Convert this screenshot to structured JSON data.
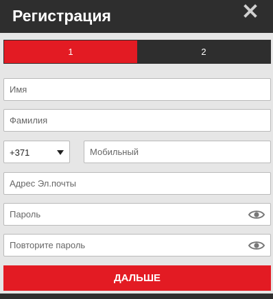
{
  "header": {
    "title": "Регистрация",
    "close_icon": "close-icon"
  },
  "steps": [
    {
      "label": "1",
      "active": true
    },
    {
      "label": "2",
      "active": false
    }
  ],
  "form": {
    "first_name": {
      "placeholder": "Имя",
      "value": ""
    },
    "last_name": {
      "placeholder": "Фамилия",
      "value": ""
    },
    "phone_code": {
      "selected": "+371"
    },
    "mobile": {
      "placeholder": "Мобильный",
      "value": ""
    },
    "email": {
      "placeholder": "Адрес Эл.почты",
      "value": ""
    },
    "password": {
      "placeholder": "Пароль",
      "value": "",
      "icon": "eye-icon"
    },
    "password_repeat": {
      "placeholder": "Повторите пароль",
      "value": "",
      "icon": "eye-icon"
    }
  },
  "submit": {
    "label": "ДАЛЬШЕ"
  },
  "colors": {
    "accent": "#e31b23",
    "dark": "#2e2e2e",
    "background": "#e6e6e6"
  }
}
